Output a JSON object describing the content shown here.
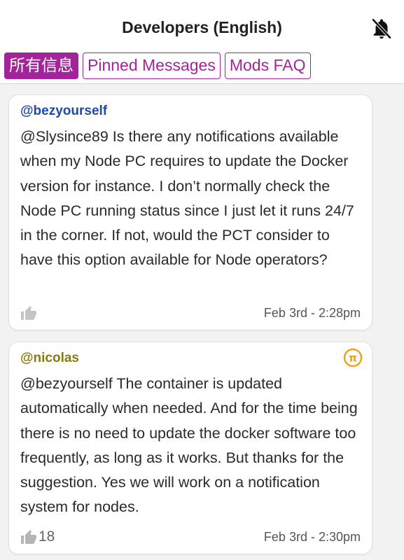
{
  "header": {
    "title": "Developers (English)",
    "bell_icon": "bell-off-icon"
  },
  "tabs": [
    {
      "label": "所有信息",
      "active": true
    },
    {
      "label": "Pinned Messages",
      "active": false
    },
    {
      "label": "Mods FAQ",
      "active": false
    }
  ],
  "messages": [
    {
      "username": "@bezyourself",
      "username_color": "#1e4aa8",
      "text": "@Slysince89 Is there any notifications available when my Node PC requires to update the Docker version for instance. I don’t normally check the Node PC running status since I just let it runs 24/7 in the corner. If not, would the PCT consider to have this option available for Node operators?",
      "likes": "",
      "time": "Feb 3rd - 2:28pm"
    },
    {
      "username": "@nicolas",
      "username_color": "#8a7a10",
      "badge_icon": "pi-coin-icon",
      "text": "@bezyourself The container is updated automatically when needed. And for the time being there is no need to update the docker software too frequently, as long as it works. But thanks for the suggestion. Yes we will work on a notification system for nodes.",
      "likes": "18",
      "time": "Feb 3rd - 2:30pm"
    }
  ],
  "colors": {
    "accent": "#a3249a",
    "pi_badge": "#f0a020"
  }
}
